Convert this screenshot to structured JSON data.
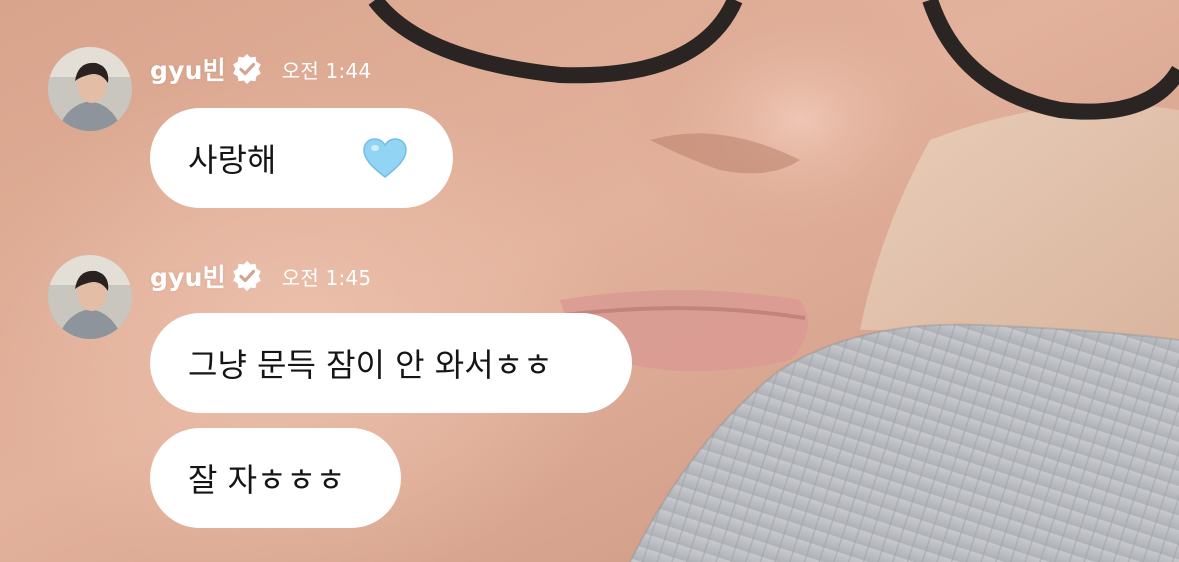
{
  "chat": {
    "groups": [
      {
        "sender": "gyu빈",
        "time": "오전 1:44",
        "verified_icon": "verified-badge-icon",
        "messages": [
          {
            "text": "사랑해",
            "emoji": "light-blue-heart-icon"
          }
        ]
      },
      {
        "sender": "gyu빈",
        "time": "오전 1:45",
        "verified_icon": "verified-badge-icon",
        "messages": [
          {
            "text": "그냥 문득 잠이 안 와서ㅎㅎ"
          },
          {
            "text": "잘 자ㅎㅎㅎ"
          }
        ]
      }
    ]
  },
  "colors": {
    "bubble": "#ffffff",
    "text": "#151515",
    "heart": "#8fd3f5",
    "name": "#ffffff"
  }
}
